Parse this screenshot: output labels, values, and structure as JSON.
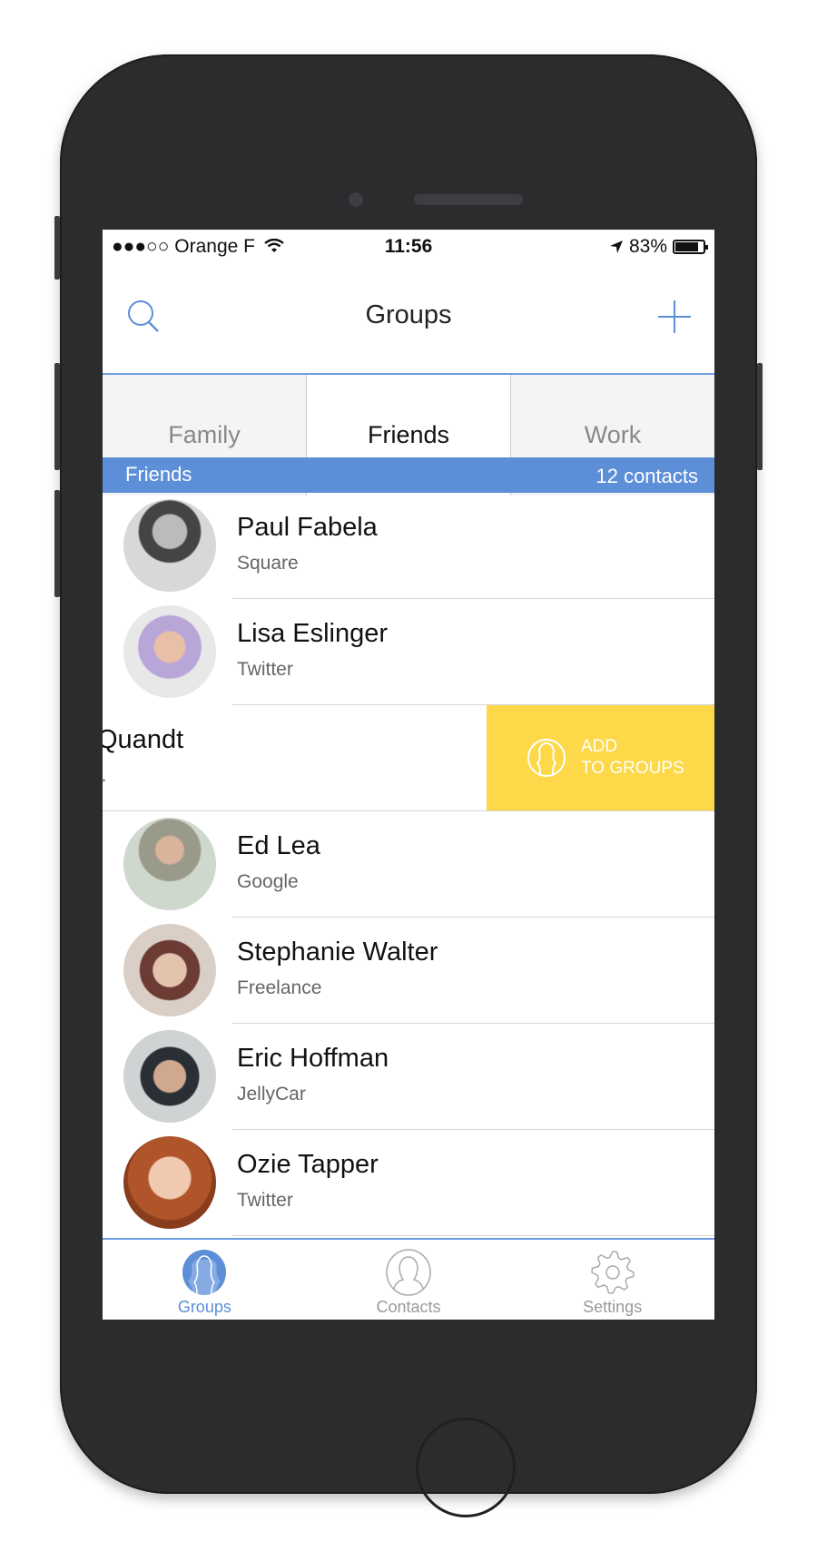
{
  "colors": {
    "accent": "#5c8fd8",
    "action": "#fdd848",
    "device": "#2b2c2e"
  },
  "status": {
    "signal": "●●●○○",
    "carrier": "Orange F",
    "wifi_icon": "wifi-icon",
    "time": "11:56",
    "location_icon": "location-arrow-icon",
    "battery": "83%",
    "battery_level": 83
  },
  "nav": {
    "title": "Groups",
    "search_icon": "search-icon",
    "add_icon": "plus-icon"
  },
  "tabs": [
    {
      "label": "Family"
    },
    {
      "label": "Friends",
      "active": true
    },
    {
      "label": "Work"
    }
  ],
  "section": {
    "title": "Friends",
    "count": "12 contacts"
  },
  "contacts": [
    {
      "name": "Paul Fabela",
      "company": "Square"
    },
    {
      "name": "Lisa Eslinger",
      "company": "Twitter"
    },
    {
      "name": "Quandt",
      "company": "c.",
      "swiped": true
    },
    {
      "name": "Ed Lea",
      "company": "Google"
    },
    {
      "name": "Stephanie Walter",
      "company": "Freelance"
    },
    {
      "name": "Eric Hoffman",
      "company": "JellyCar"
    },
    {
      "name": "Ozie Tapper",
      "company": "Twitter"
    }
  ],
  "swipe_action": {
    "line1": "ADD",
    "line2": "TO GROUPS",
    "icon": "group-icon"
  },
  "tabbar": [
    {
      "label": "Groups",
      "icon": "groups-icon",
      "active": true
    },
    {
      "label": "Contacts",
      "icon": "contact-icon"
    },
    {
      "label": "Settings",
      "icon": "gear-icon"
    }
  ]
}
